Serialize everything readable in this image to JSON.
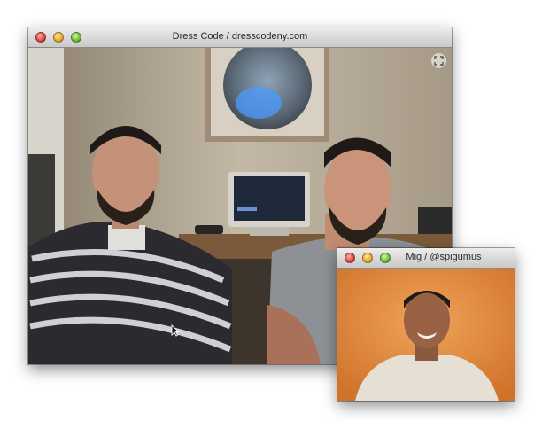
{
  "main_window": {
    "title": "Dress Code / dresscodeny.com"
  },
  "mini_window": {
    "title": "Mig / @spigumus"
  },
  "icons": {
    "fullscreen": "fullscreen-arrows-icon",
    "cursor": "mouse-pointer-icon"
  }
}
